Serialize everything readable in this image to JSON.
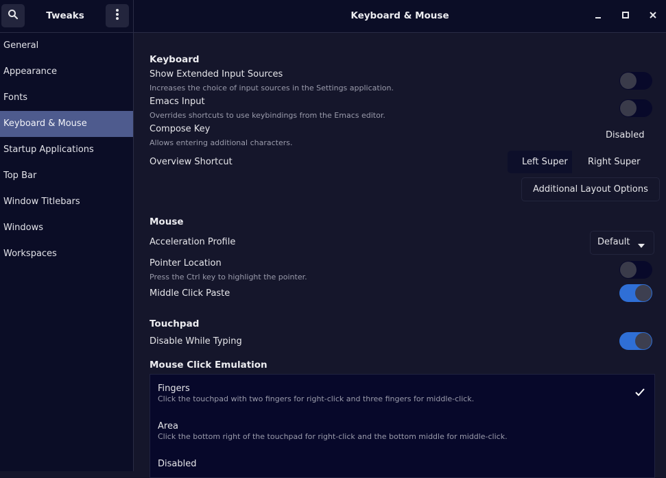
{
  "header": {
    "app_title": "Tweaks",
    "page_title": "Keyboard & Mouse",
    "icons": {
      "search": "search-icon",
      "menu": "kebab-menu-icon",
      "minimize": "minimize-icon",
      "maximize": "maximize-icon",
      "close": "close-icon"
    }
  },
  "sidebar": {
    "items": [
      {
        "label": "General"
      },
      {
        "label": "Appearance"
      },
      {
        "label": "Fonts"
      },
      {
        "label": "Keyboard & Mouse",
        "active": true
      },
      {
        "label": "Startup Applications"
      },
      {
        "label": "Top Bar"
      },
      {
        "label": "Window Titlebars"
      },
      {
        "label": "Windows"
      },
      {
        "label": "Workspaces"
      }
    ]
  },
  "keyboard": {
    "section_title": "Keyboard",
    "show_extended": {
      "label": "Show Extended Input Sources",
      "desc": "Increases the choice of input sources in the Settings application.",
      "enabled": false
    },
    "emacs": {
      "label": "Emacs Input",
      "desc": "Overrides shortcuts to use keybindings from the Emacs editor.",
      "enabled": false
    },
    "compose": {
      "label": "Compose Key",
      "desc": "Allows entering additional characters.",
      "value": "Disabled"
    },
    "overview": {
      "label": "Overview Shortcut",
      "options": [
        "Left Super",
        "Right Super"
      ],
      "selected": "Left Super"
    },
    "additional_layout": "Additional Layout Options"
  },
  "mouse": {
    "section_title": "Mouse",
    "accel": {
      "label": "Acceleration Profile",
      "value": "Default"
    },
    "pointer_location": {
      "label": "Pointer Location",
      "desc": "Press the Ctrl key to highlight the pointer.",
      "enabled": false
    },
    "middle_click": {
      "label": "Middle Click Paste",
      "enabled": true
    }
  },
  "touchpad": {
    "section_title": "Touchpad",
    "disable_typing": {
      "label": "Disable While Typing",
      "enabled": true
    }
  },
  "click_emulation": {
    "section_title": "Mouse Click Emulation",
    "options": [
      {
        "label": "Fingers",
        "desc": "Click the touchpad with two fingers for right-click and three fingers for middle-click.",
        "selected": true
      },
      {
        "label": "Area",
        "desc": "Click the bottom right of the touchpad for right-click and the bottom middle for middle-click.",
        "selected": false
      },
      {
        "label": "Disabled",
        "desc": "",
        "selected": false
      }
    ]
  },
  "colors": {
    "accent": "#2f6fd6",
    "sidebar_active": "#4e5b8e",
    "background": "#15162b",
    "sidebar_bg": "#0b0d26"
  }
}
